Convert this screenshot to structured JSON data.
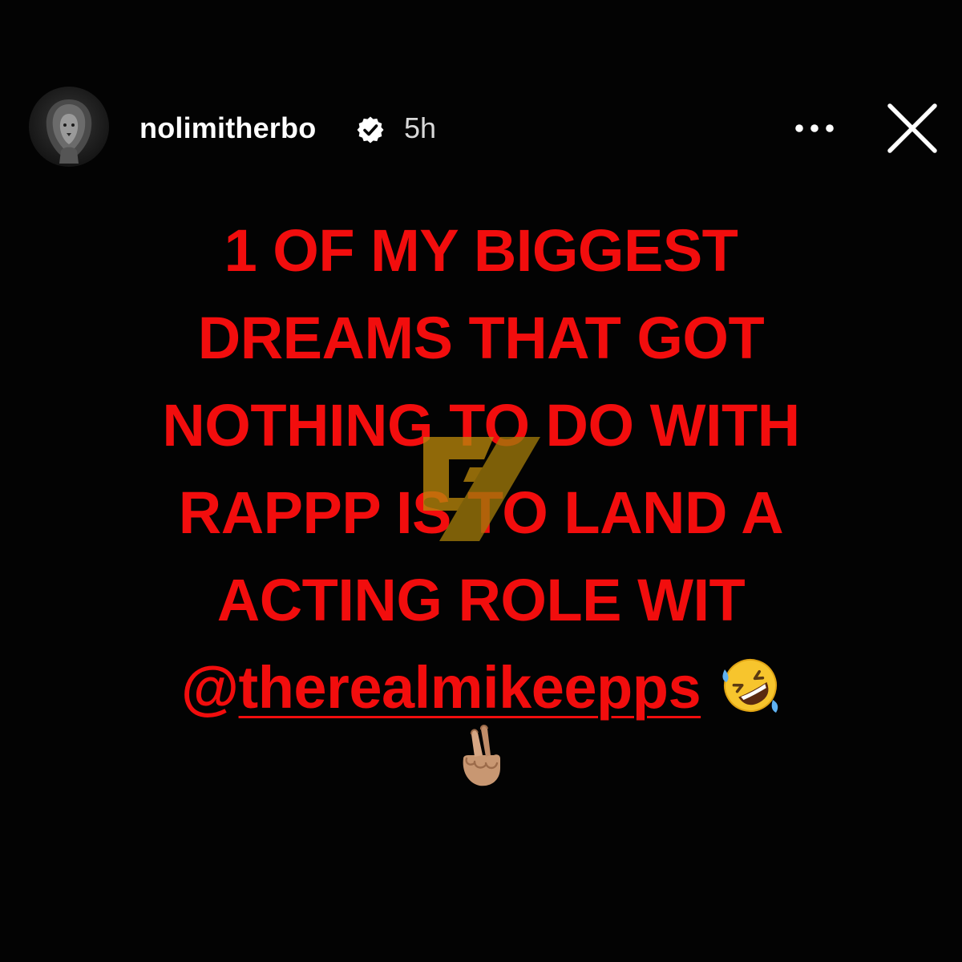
{
  "story": {
    "username": "nolimitherbo",
    "verified": true,
    "timestamp": "5h",
    "lines": [
      "1 OF MY BIGGEST",
      "DREAMS THAT GOT",
      "NOTHING TO DO WITH",
      "RAPPP IS TO LAND A",
      "ACTING ROLE WIT"
    ],
    "mention_prefix": "@",
    "mention": "therealmikeepps",
    "emojis": [
      "rolling-on-floor-laughing",
      "crossed-fingers"
    ]
  },
  "colors": {
    "background": "#030303",
    "story_text": "#f20d0d",
    "header_text": "#ffffff",
    "watermark": "#b8860b"
  },
  "icons": {
    "verified": "verified-badge-icon",
    "more": "more-options-icon",
    "close": "close-icon"
  }
}
